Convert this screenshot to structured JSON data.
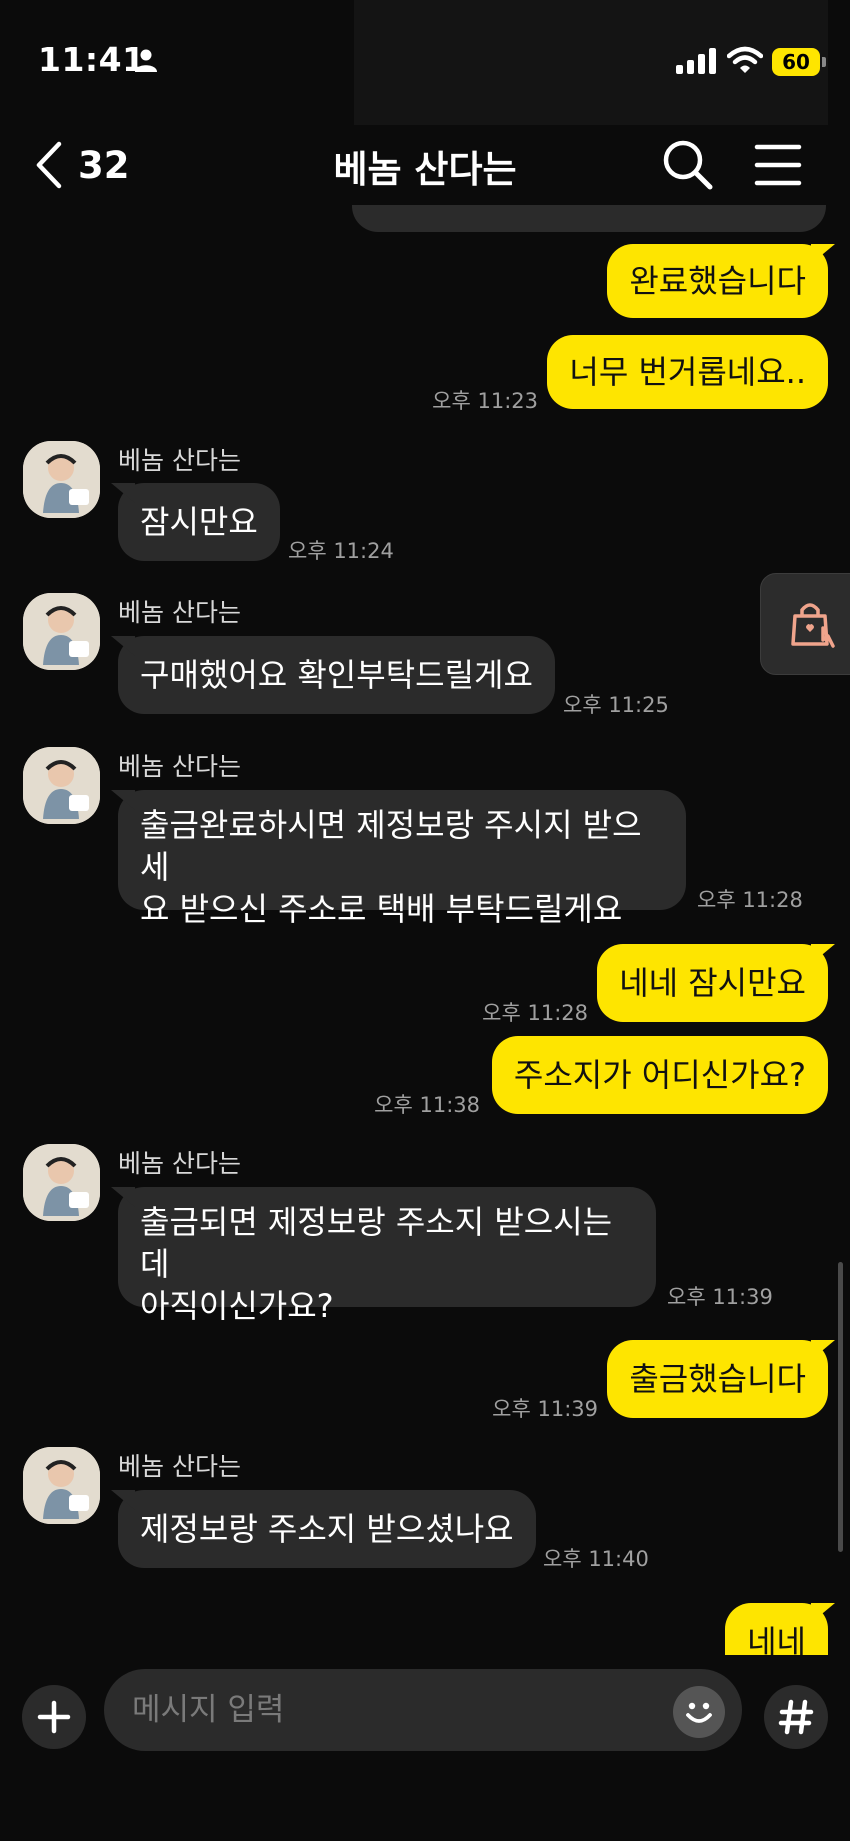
{
  "status_bar": {
    "time": "11:41",
    "battery_level": "60"
  },
  "header": {
    "back_count": "32",
    "title": "베놈 산다는"
  },
  "messages": [
    {
      "from": "me",
      "text": "완료했습니다"
    },
    {
      "from": "me",
      "text": "너무 번거롭네요..",
      "time": "오후 11:23"
    },
    {
      "from": "them",
      "sender": "베놈 산다는",
      "text": "잠시만요",
      "time": "오후 11:24"
    },
    {
      "from": "them",
      "sender": "베놈 산다는",
      "text": "구매했어요 확인부탁드릴게요",
      "time": "오후 11:25"
    },
    {
      "from": "them",
      "sender": "베놈 산다는",
      "lines": [
        "출금완료하시면 제정보랑 주시지 받으세",
        "요 받으신 주소로 택배 부탁드릴게요"
      ],
      "time": "오후 11:28"
    },
    {
      "from": "me",
      "text": "네네 잠시만요",
      "time": "오후 11:28"
    },
    {
      "from": "me",
      "text": "주소지가 어디신가요?",
      "time": "오후 11:38"
    },
    {
      "from": "them",
      "sender": "베놈 산다는",
      "lines": [
        "출금되면 제정보랑 주소지 받으시는데",
        "아직이신가요?"
      ],
      "time": "오후 11:39"
    },
    {
      "from": "me",
      "text": "출금했습니다",
      "time": "오후 11:39"
    },
    {
      "from": "them",
      "sender": "베놈 산다는",
      "text": "제정보랑 주소지 받으셨나요",
      "time": "오후 11:40"
    },
    {
      "from": "me",
      "text": "네네"
    }
  ],
  "input": {
    "placeholder": "메시지 입력"
  },
  "colors": {
    "my_bubble": "#fee500",
    "their_bubble": "#2b2b2b",
    "background": "#0b0b0b"
  }
}
